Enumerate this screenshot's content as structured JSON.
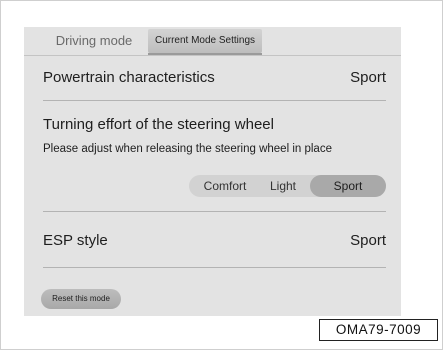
{
  "tabs": {
    "driving_mode": "Driving mode",
    "current_mode_settings": "Current Mode Settings"
  },
  "powertrain": {
    "label": "Powertrain characteristics",
    "value": "Sport"
  },
  "steering": {
    "title": "Turning effort of the steering wheel",
    "subtitle": "Please adjust when releasing the steering wheel in place",
    "options": [
      "Comfort",
      "Light",
      "Sport"
    ],
    "selected": "Sport"
  },
  "esp": {
    "label": "ESP style",
    "value": "Sport"
  },
  "reset_label": "Reset this mode",
  "figure_code": "OMA79-7009"
}
